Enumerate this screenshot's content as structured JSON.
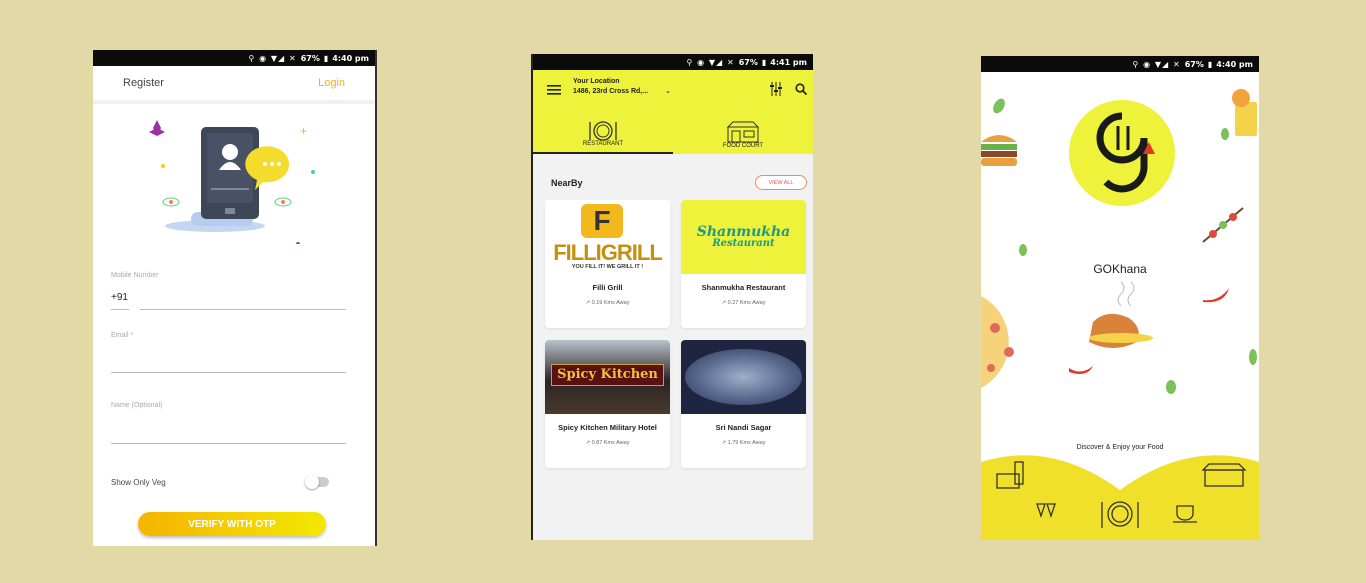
{
  "status_bars": [
    {
      "battery": "67%",
      "time": "4:40 pm"
    },
    {
      "battery": "67%",
      "time": "4:41 pm"
    },
    {
      "battery": "67%",
      "time": "4:40 pm"
    }
  ],
  "login_screen": {
    "register_label": "Register",
    "login_label": "Login",
    "mobile_label": "Mobile Number",
    "country_code": "+91",
    "email_label": "Email *",
    "name_label": "Name (Optional)",
    "veg_label": "Show Only Veg",
    "verify_label": "VERIFY WITH OTP"
  },
  "home_screen": {
    "location_title": "Your Location",
    "location_address": "1486, 23rd Cross Rd,...",
    "tabs": [
      {
        "label": "RESTAURANT",
        "icon": "plate-icon"
      },
      {
        "label": "FOOD COURT",
        "icon": "shop-icon"
      }
    ],
    "nearby_title": "NearBy",
    "view_all_label": "VIEW ALL",
    "restaurants": [
      {
        "name": "Filli Grill",
        "distance": "0.19 Kms Away",
        "logo_text": "FILLIGRILL",
        "logo_sub": "YOU FILL IT! WE GRILL IT !"
      },
      {
        "name": "Shanmukha Restaurant",
        "distance": "0.27 Kms Away",
        "logo_text": "Shanmukha",
        "logo_sub": "Restaurant"
      },
      {
        "name": "Spicy Kitchen Military Hotel",
        "distance": "0.87 Kms Away",
        "logo_text": "Spicy Kitchen",
        "logo_sub": ""
      },
      {
        "name": "Sri Nandi Sagar",
        "distance": "1.79 Kms Away",
        "logo_text": "",
        "logo_sub": ""
      }
    ]
  },
  "splash_screen": {
    "app_name": "GOKhana",
    "tagline": "Discover & Enjoy your Food"
  },
  "colors": {
    "background": "#e2d9a6",
    "accent_yellow": "#eef23a",
    "login_orange": "#f5b400"
  }
}
